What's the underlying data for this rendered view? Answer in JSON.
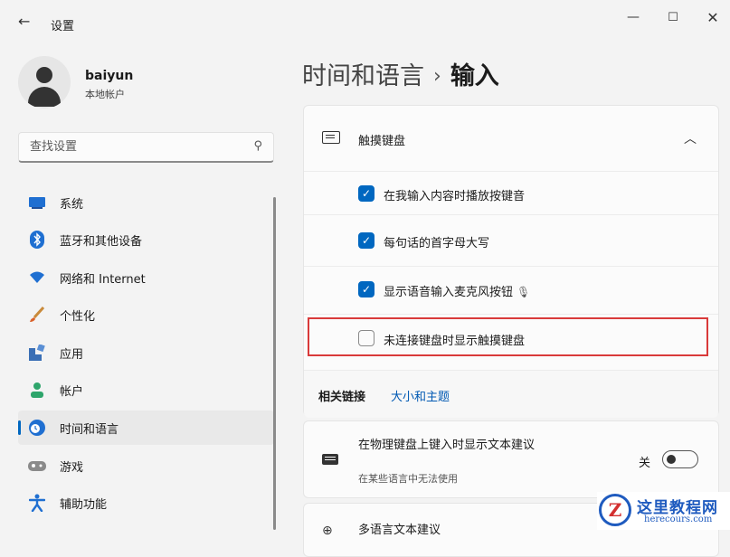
{
  "window": {
    "title": "设置",
    "back_icon": "back-arrow-icon",
    "min_glyph": "—",
    "max_glyph": "☐",
    "close_glyph": "✕"
  },
  "profile": {
    "name": "baiyun",
    "subtitle": "本地帐户"
  },
  "search": {
    "placeholder": "查找设置"
  },
  "nav": {
    "items": [
      {
        "label": "系统",
        "icon": "system-display-icon",
        "active": false
      },
      {
        "label": "蓝牙和其他设备",
        "icon": "bluetooth-icon",
        "active": false
      },
      {
        "label": "网络和 Internet",
        "icon": "wifi-icon",
        "active": false
      },
      {
        "label": "个性化",
        "icon": "brush-icon",
        "active": false
      },
      {
        "label": "应用",
        "icon": "apps-icon",
        "active": false
      },
      {
        "label": "帐户",
        "icon": "account-icon",
        "active": false
      },
      {
        "label": "时间和语言",
        "icon": "time-language-icon",
        "active": true
      },
      {
        "label": "游戏",
        "icon": "gamepad-icon",
        "active": false
      },
      {
        "label": "辅助功能",
        "icon": "accessibility-icon",
        "active": false
      }
    ]
  },
  "breadcrumb": {
    "parent": "时间和语言",
    "separator": "›",
    "current": "输入"
  },
  "touch_keyboard": {
    "title": "触摸键盘",
    "expanded": true,
    "options": [
      {
        "label": "在我输入内容时播放按键音",
        "checked": true
      },
      {
        "label": "每句话的首字母大写",
        "checked": true
      },
      {
        "label": "显示语音输入麦克风按钮",
        "checked": true
      },
      {
        "label": "未连接键盘时显示触摸键盘",
        "checked": false
      }
    ],
    "related_title": "相关链接",
    "related_link": "大小和主题"
  },
  "physical_keyboard": {
    "title": "在物理键盘上键入时显示文本建议",
    "subtitle": "在某些语言中无法使用",
    "toggle_label": "关",
    "toggle_on": false
  },
  "multilingual": {
    "title": "多语言文本建议"
  },
  "colors": {
    "accent": "#0067c0",
    "highlight": "#d93a3a",
    "link": "#0059b3"
  },
  "watermark": {
    "title": "这里教程网",
    "url": "herecours.com"
  }
}
